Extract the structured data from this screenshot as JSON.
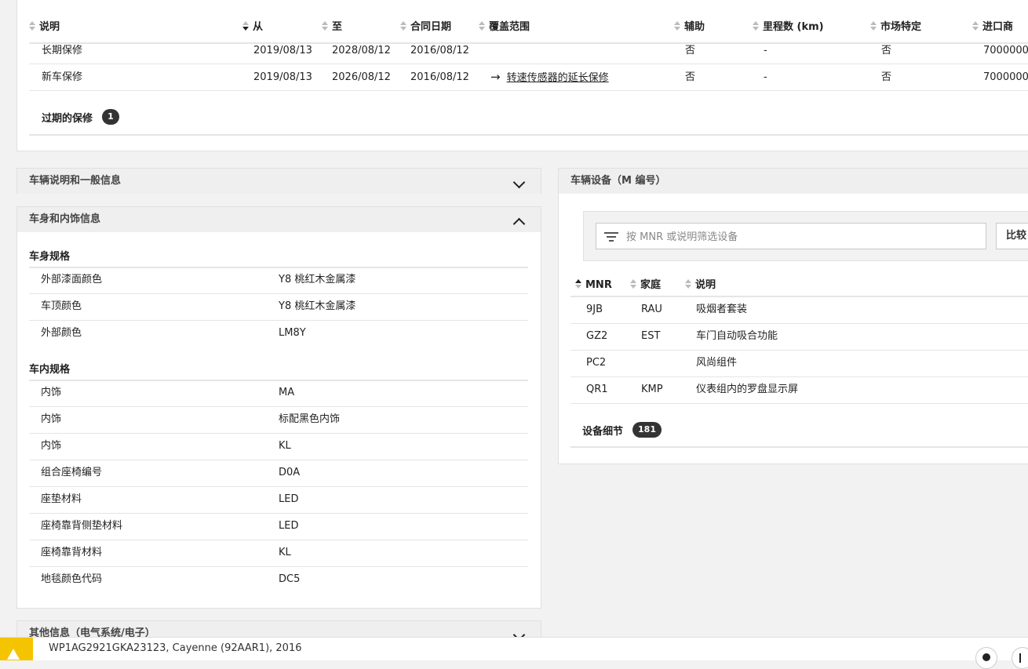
{
  "warranty": {
    "columns": [
      "说明",
      "从",
      "至",
      "合同日期",
      "覆盖范围",
      "辅助",
      "里程数 (km)",
      "市场特定",
      "进口商"
    ],
    "rows": [
      {
        "desc": "长期保修",
        "from": "2019/08/13",
        "to": "2028/08/12",
        "contract": "2016/08/12",
        "coverage": "",
        "aux": "否",
        "mileage": "-",
        "market": "否",
        "importer": "7000000"
      },
      {
        "desc": "新车保修",
        "from": "2019/08/13",
        "to": "2026/08/12",
        "contract": "2016/08/12",
        "coverage": "转速传感器的延长保修",
        "aux": "否",
        "mileage": "-",
        "market": "否",
        "importer": "7000000"
      }
    ],
    "expired_label": "过期的保修",
    "expired_count": "1"
  },
  "vehicle_info_panel": {
    "title": "车辆说明和一般信息"
  },
  "body_panel": {
    "title": "车身和内饰信息",
    "exterior_title": "车身规格",
    "exterior": [
      {
        "label": "外部漆面颜色",
        "value": "Y8 桃红木金属漆"
      },
      {
        "label": "车顶颜色",
        "value": "Y8 桃红木金属漆"
      },
      {
        "label": "外部颜色",
        "value": "LM8Y"
      }
    ],
    "interior_title": "车内规格",
    "interior": [
      {
        "label": "内饰",
        "value": "MA"
      },
      {
        "label": "内饰",
        "value": "标配黑色内饰"
      },
      {
        "label": "内饰",
        "value": "KL"
      },
      {
        "label": "组合座椅编号",
        "value": "D0A"
      },
      {
        "label": "座垫材料",
        "value": "LED"
      },
      {
        "label": "座椅靠背侧垫材料",
        "value": "LED"
      },
      {
        "label": "座椅靠背材料",
        "value": "KL"
      },
      {
        "label": "地毯颜色代码",
        "value": "DC5"
      }
    ]
  },
  "other_panel": {
    "title": "其他信息（电气系统/电子）"
  },
  "equipment": {
    "title": "车辆设备（M 编号）",
    "filter_placeholder": "按 MNR 或说明筛选设备",
    "compare_label": "比较",
    "columns": [
      "MNR",
      "家庭",
      "说明"
    ],
    "rows": [
      {
        "mnr": "9JB",
        "family": "RAU",
        "desc": "吸烟者套装"
      },
      {
        "mnr": "GZ2",
        "family": "EST",
        "desc": "车门自动吸合功能"
      },
      {
        "mnr": "PC2",
        "family": "",
        "desc": "风尚组件"
      },
      {
        "mnr": "QR1",
        "family": "KMP",
        "desc": "仪表组内的罗盘显示屏"
      }
    ],
    "detail_label": "设备细节",
    "detail_count": "181"
  },
  "footer": {
    "vehicle": "WP1AG2921GKA23123, Cayenne (92AAR1), 2016",
    "warning_color": "#f5c400"
  }
}
